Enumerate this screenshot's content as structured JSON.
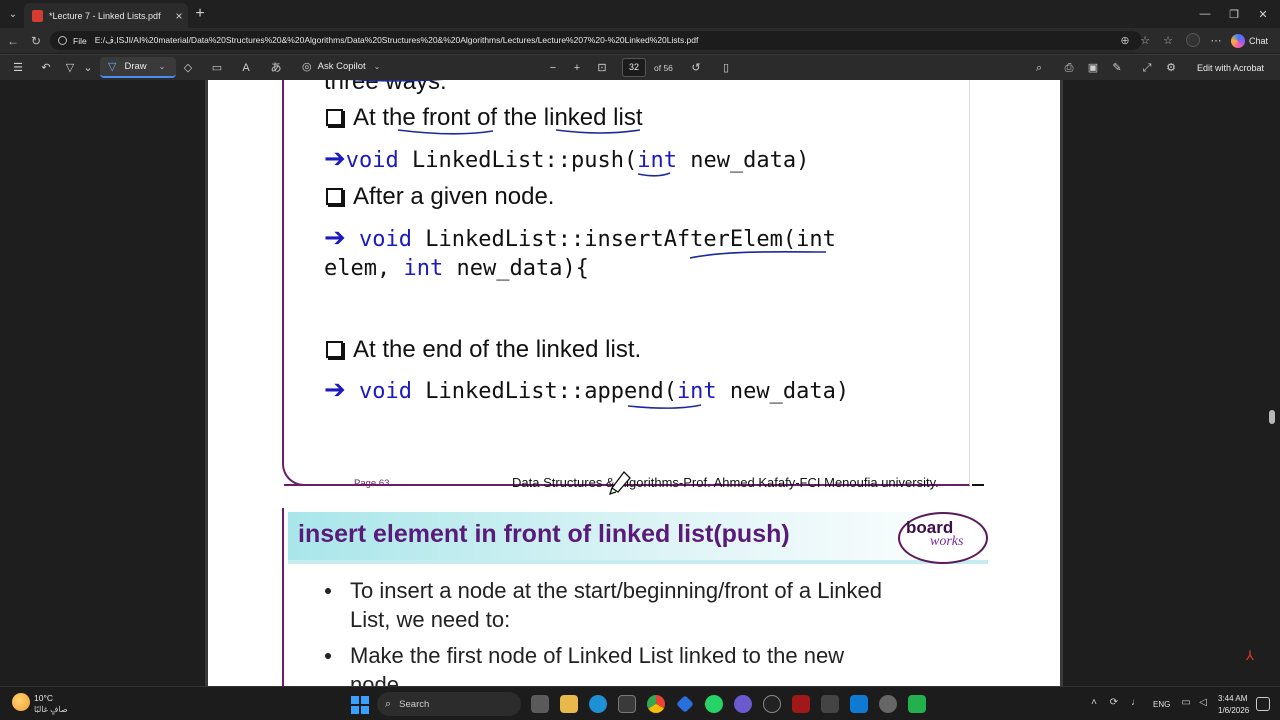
{
  "browser": {
    "tab_title": "*Lecture 7 - Linked Lists.pdf",
    "url_scheme": "File",
    "url": "E:/ڤ,ISJI/AI%20material/Data%20Structures%20&%20Algorithms/Data%20Structures%20&%20Algorithms/Lectures/Lecture%207%20-%20Linked%20Lists.pdf",
    "chat_label": "Chat"
  },
  "toolbar": {
    "draw_label": "Draw",
    "ask_copilot_label": "Ask Copilot",
    "current_page": "32",
    "page_of": "of 56",
    "edit_acrobat_label": "Edit with Acrobat"
  },
  "slide1": {
    "top_partial": "three ways:",
    "item1": "At the front of the linked list",
    "code1_kw": "void",
    "code1_fn": " LinkedList::push(",
    "code1_kw2": "int",
    "code1_rest": " new_data)",
    "item2": "After a given node.",
    "code2_kw": "void",
    "code2_fn": " LinkedList::insertAfterElem(int",
    "code2_line2_a": "elem, ",
    "code2_kw2": "int",
    "code2_line2_b": " new_data){",
    "item3": "At the end of the linked list.",
    "code3_kw": "void",
    "code3_fn": " LinkedList::append(",
    "code3_kw2": "int",
    "code3_rest": " new_data)",
    "footer_page": "Page 63",
    "footer_text": "Data Structures & Algorithms-Prof. Ahmed Kafafy-FCI Menoufia university."
  },
  "slide2": {
    "title": "insert element in front of linked list(push)",
    "logo_board": "board",
    "logo_works": "works",
    "bullet1_line1": "To insert a node at the start/beginning/front of a Linked",
    "bullet1_line2": "List, we need to:",
    "bullet2_line1": "Make the first node of Linked List linked to the new",
    "bullet2_line2": "node"
  },
  "taskbar": {
    "weather_temp": "10°C",
    "weather_desc": "صافٍ غالبًا",
    "search_label": "Search",
    "language": "ENG",
    "time": "3:44 AM",
    "date": "1/6/2026"
  },
  "colors": {
    "keyword": "#1a1abf",
    "slide_border": "#6a1e6a",
    "slide_title": "#5a1a7a"
  }
}
